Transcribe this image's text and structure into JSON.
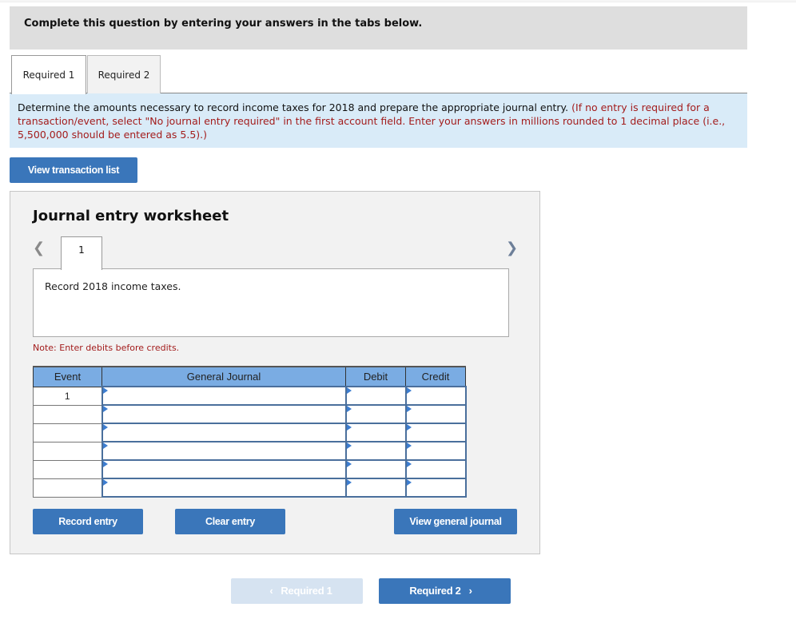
{
  "header": {
    "title": "Complete this question by entering your answers in the tabs below."
  },
  "tabs": [
    {
      "label": "Required 1",
      "active": true
    },
    {
      "label": "Required 2",
      "active": false
    }
  ],
  "instructions": {
    "main": "Determine the amounts necessary to record income taxes for 2018 and prepare the appropriate journal entry.",
    "note": "(If no entry is required for a transaction/event, select \"No journal entry required\" in the first account field. Enter your answers in millions rounded to 1 decimal place (i.e., 5,500,000 should be entered as 5.5).)"
  },
  "buttons": {
    "view_transaction_list": "View transaction list",
    "record_entry": "Record entry",
    "clear_entry": "Clear entry",
    "view_general_journal": "View general journal",
    "prev_required": "Required 1",
    "next_required": "Required 2"
  },
  "worksheet": {
    "title": "Journal entry worksheet",
    "entry_tab": "1",
    "description": "Record 2018 income taxes.",
    "note": "Note: Enter debits before credits.",
    "columns": [
      "Event",
      "General Journal",
      "Debit",
      "Credit"
    ],
    "rows": [
      {
        "event": "1",
        "account": "",
        "debit": "",
        "credit": ""
      },
      {
        "event": "",
        "account": "",
        "debit": "",
        "credit": ""
      },
      {
        "event": "",
        "account": "",
        "debit": "",
        "credit": ""
      },
      {
        "event": "",
        "account": "",
        "debit": "",
        "credit": ""
      },
      {
        "event": "",
        "account": "",
        "debit": "",
        "credit": ""
      },
      {
        "event": "",
        "account": "",
        "debit": "",
        "credit": ""
      }
    ]
  },
  "icons": {
    "prev": "chevron-left-icon",
    "next": "chevron-right-icon"
  },
  "colors": {
    "button_blue": "#3a76ba",
    "button_disabled": "#d6e3f1",
    "header_blue": "#7aace3",
    "instruction_bg": "#d9ebf8",
    "note_red": "#a31c1c"
  }
}
